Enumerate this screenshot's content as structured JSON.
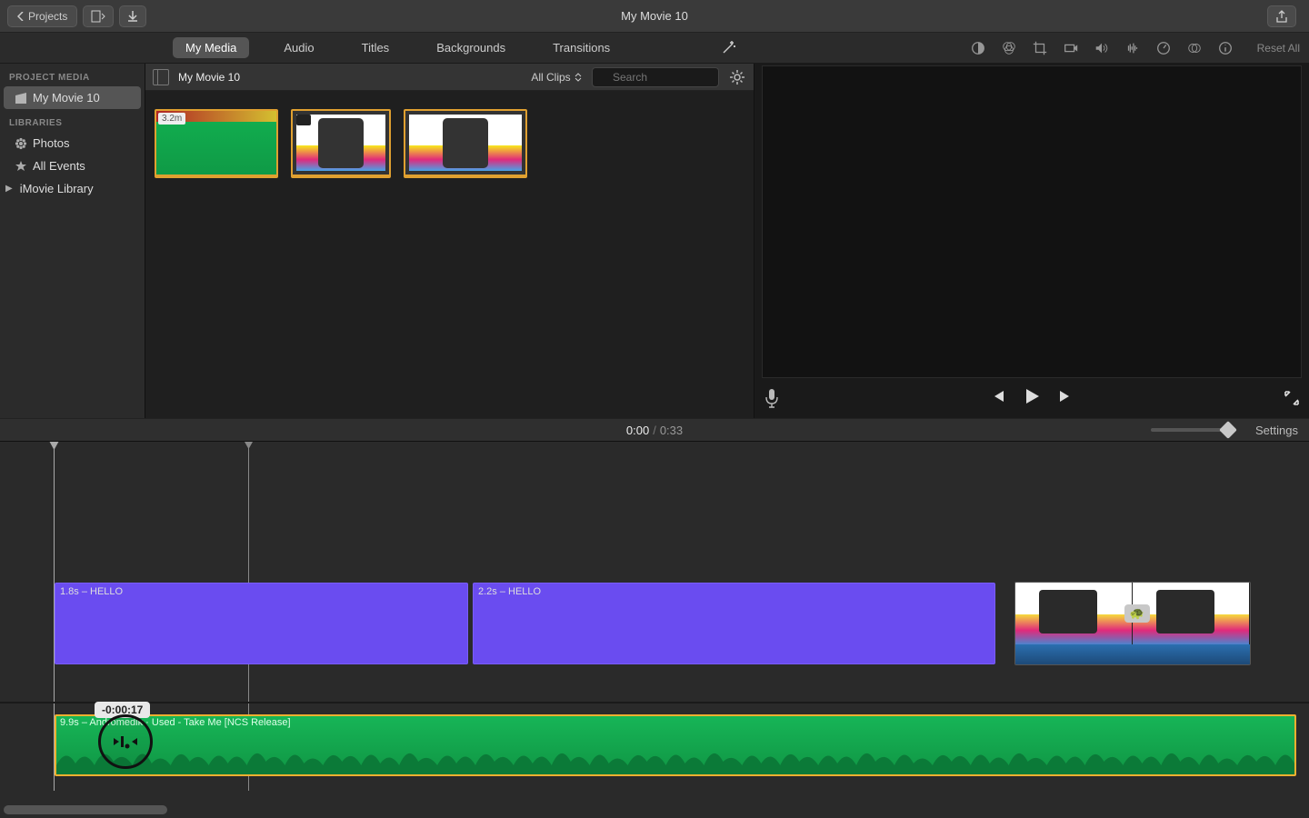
{
  "titlebar": {
    "back_label": "Projects",
    "title": "My Movie 10"
  },
  "tabs": {
    "my_media": "My Media",
    "audio": "Audio",
    "titles": "Titles",
    "backgrounds": "Backgrounds",
    "transitions": "Transitions",
    "reset_all": "Reset All"
  },
  "sidebar": {
    "project_media_heading": "PROJECT MEDIA",
    "project_name": "My Movie 10",
    "libraries_heading": "LIBRARIES",
    "photos": "Photos",
    "all_events": "All Events",
    "imovie_library": "iMovie Library"
  },
  "browser": {
    "title": "My Movie 10",
    "filter_label": "All Clips",
    "search_placeholder": "Search",
    "clip1_duration": "3.2m"
  },
  "timebar": {
    "current": "0:00",
    "total": "0:33",
    "settings": "Settings"
  },
  "timeline": {
    "title_clip_1": "1.8s – HELLO",
    "title_clip_2": "2.2s – HELLO",
    "audio_clip": "9.9s – Andromedik · Used - Take Me [NCS Release]",
    "trim_time": "-0:00:17"
  }
}
